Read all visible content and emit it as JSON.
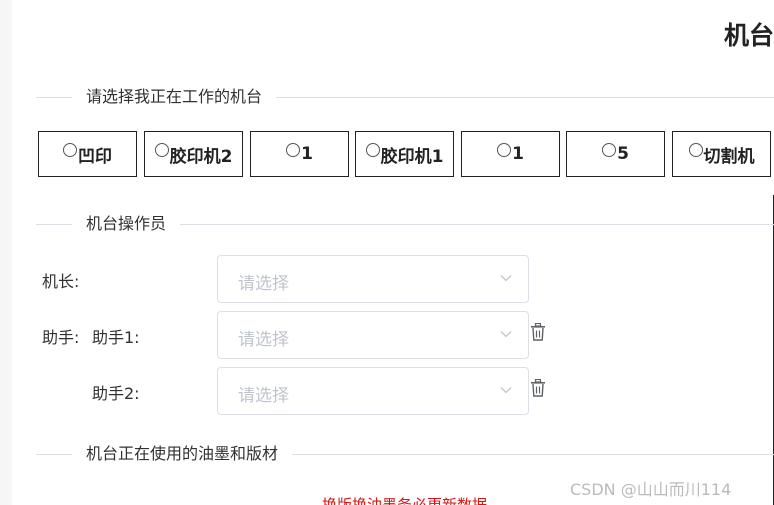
{
  "header": {
    "title": "机台"
  },
  "sections": {
    "machine_select": "请选择我正在工作的机台",
    "operators": "机台操作员",
    "ink_plates": "机台正在使用的油墨和版材"
  },
  "machines": [
    "凹印",
    "胶印机2",
    "1",
    "胶印机1",
    "1",
    "5",
    "切割机"
  ],
  "operators": {
    "captain_label": "机长:",
    "assistant_label": "助手:",
    "assistant1_label": "助手1:",
    "assistant2_label": "助手2:",
    "placeholder": "请选择"
  },
  "warning": "换版换油墨务必更新数据",
  "watermark": "CSDN @山山而川114",
  "colors": {
    "warning": "#dd1111",
    "placeholder": "#c0c4cc",
    "border": "#dcdfe6"
  },
  "icons": {
    "dropdown": "chevron-down-icon",
    "delete": "trash-icon"
  }
}
